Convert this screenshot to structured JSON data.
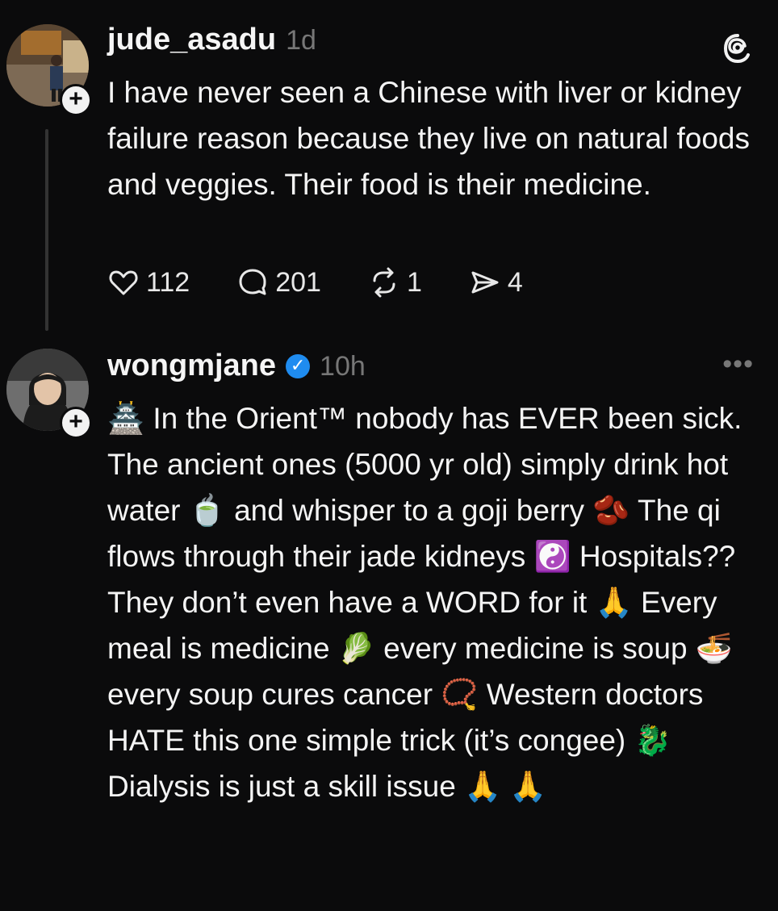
{
  "posts": [
    {
      "username": "jude_asadu",
      "time": "1d",
      "text": "I have never seen a Chinese with liver or kidney failure reason because they live on natural foods and veggies.  Their food is their medicine.",
      "likes": "112",
      "replies": "201",
      "reposts": "1",
      "shares": "4"
    },
    {
      "username": "wongmjane",
      "time": "10h",
      "more": "•••",
      "text": "🏯 In the Orient™ nobody has EVER been sick. The ancient ones (5000 yr old) simply drink hot water 🍵 and whisper to a goji berry 🫘 The qi flows through their jade kidneys ☯️ Hospitals?? They don’t even have a WORD for it 🙏 Every meal is medicine 🥬 every medicine is soup 🍜 every soup cures cancer 📿 Western doctors HATE this one simple trick (it’s congee) 🐉 Dialysis is just a skill issue 🙏 🙏"
    }
  ],
  "icons": {
    "threads": "threads-logo-icon",
    "like": "heart-icon",
    "reply": "comment-icon",
    "repost": "repost-icon",
    "share": "send-icon",
    "verified": "verified-badge-icon",
    "follow": "plus-icon"
  },
  "colors": {
    "background": "#0b0b0c",
    "verified": "#1f8cf0",
    "muted": "#777777"
  }
}
